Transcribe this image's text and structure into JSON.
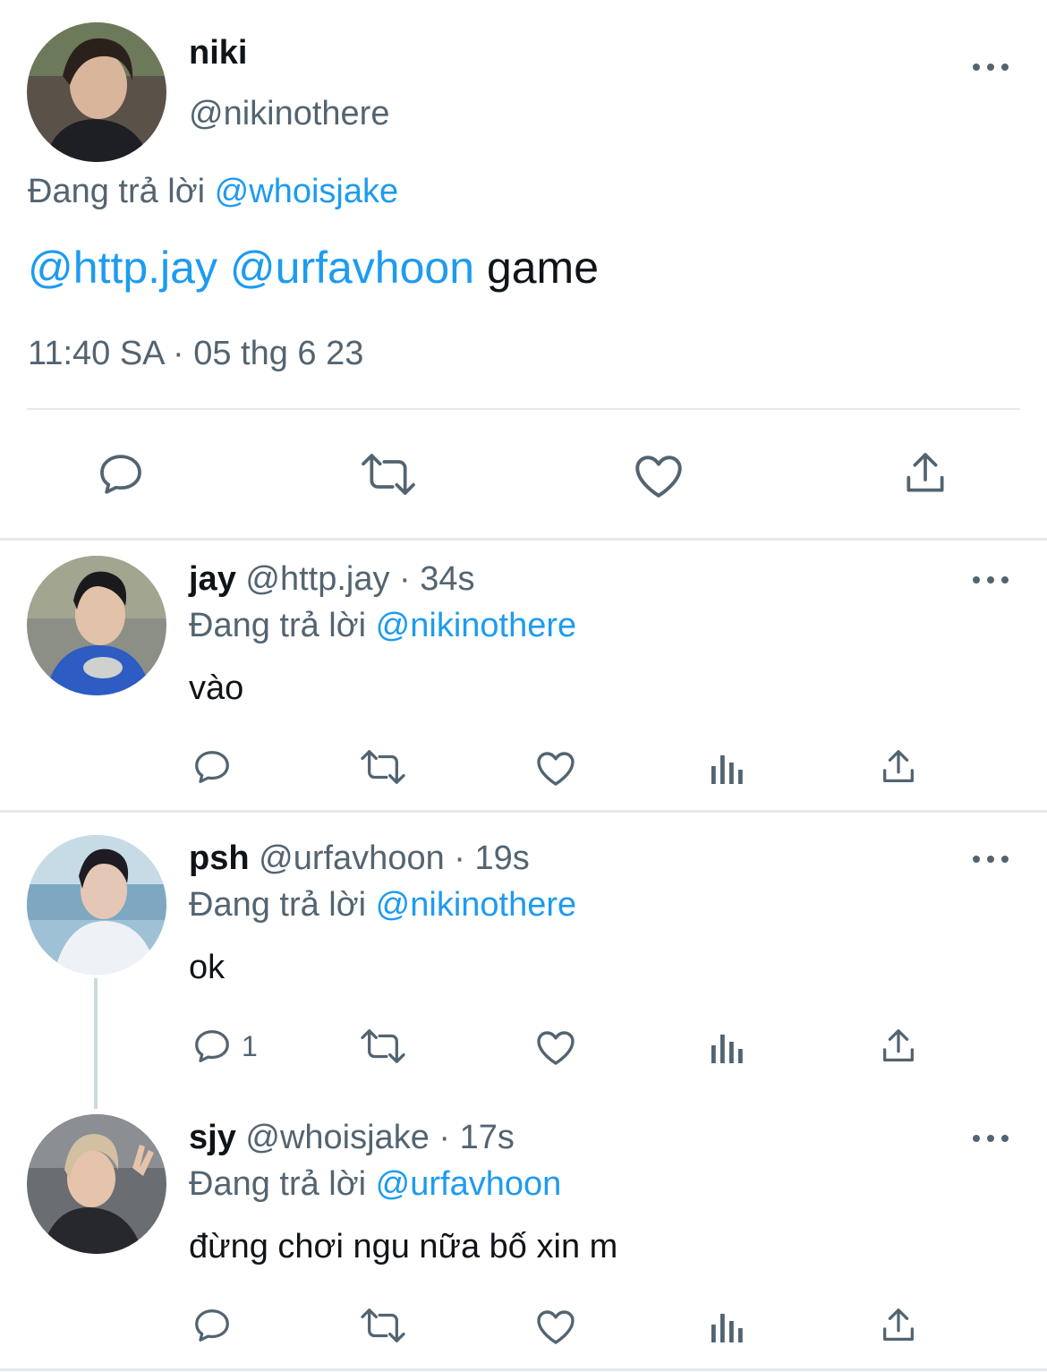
{
  "main_tweet": {
    "name": "niki",
    "handle": "@nikinothere",
    "replying_prefix": "Đang trả lời ",
    "replying_to": "@whoisjake",
    "mention_1": "@http.jay",
    "mention_2": "@urfavhoon",
    "text": "game",
    "timestamp": "11:40 SA · 05 thg 6 23",
    "avatar_icon": "avatar-photo"
  },
  "replies": [
    {
      "name": "jay",
      "handle": "@http.jay",
      "time": "· 34s",
      "replying_prefix": "Đang trả lời ",
      "replying_to": "@nikinothere",
      "text": "vào",
      "reply_count": ""
    },
    {
      "name": "psh",
      "handle": "@urfavhoon",
      "time": "· 19s",
      "replying_prefix": "Đang trả lời ",
      "replying_to": "@nikinothere",
      "text": "ok",
      "reply_count": "1"
    },
    {
      "name": "sjy",
      "handle": "@whoisjake",
      "time": "· 17s",
      "replying_prefix": "Đang trả lời ",
      "replying_to": "@urfavhoon",
      "text": "đừng chơi ngu nữa bố xin m",
      "reply_count": ""
    }
  ],
  "icons": {
    "reply": "reply-icon",
    "retweet": "retweet-icon",
    "like": "heart-icon",
    "views": "views-icon",
    "share": "share-icon",
    "more": "more-icon"
  },
  "colors": {
    "link": "#1d9bf0",
    "secondary_text": "#536471",
    "primary_text": "#0f1419",
    "divider": "#e6e9ec"
  }
}
